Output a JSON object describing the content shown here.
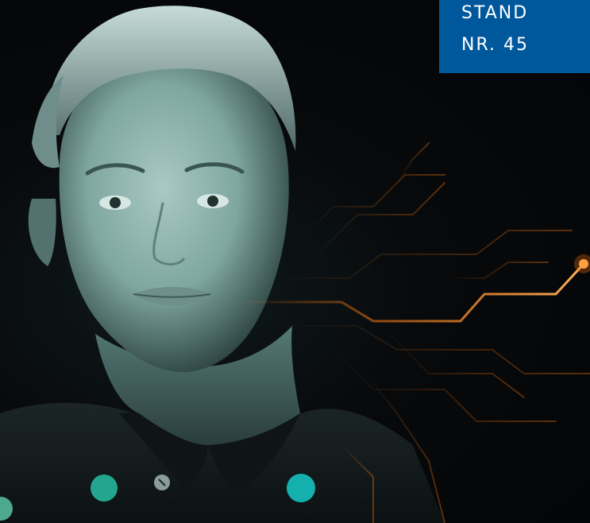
{
  "badge": {
    "line1": "STAND",
    "line2": "NR. 45",
    "color": "#00589c"
  },
  "colors": {
    "circuit": "#ff7a10",
    "dot_green": "#4ea88c",
    "dot_teal": "#22a690",
    "dot_cyan": "#15b0ad"
  }
}
